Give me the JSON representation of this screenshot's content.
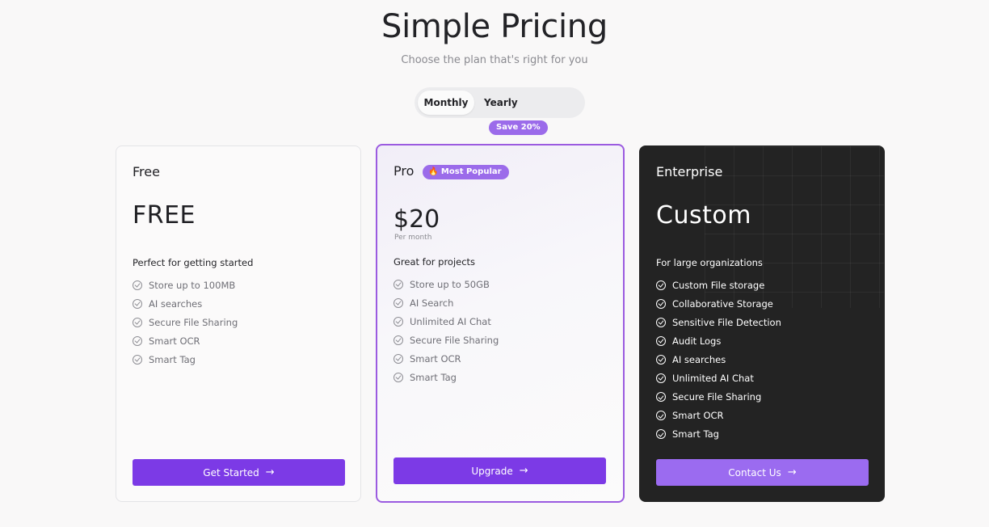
{
  "header": {
    "title": "Simple Pricing",
    "subtitle": "Choose the plan that's right for you"
  },
  "billing_toggle": {
    "monthly_label": "Monthly",
    "yearly_label": "Yearly",
    "save_badge": "Save 20%",
    "selected": "Monthly"
  },
  "plans": [
    {
      "name": "Free",
      "price": "FREE",
      "tagline": "Perfect for getting started",
      "features": [
        "Store up to 100MB",
        "AI searches",
        "Secure File Sharing",
        "Smart OCR",
        "Smart Tag"
      ],
      "cta": "Get Started"
    },
    {
      "name": "Pro",
      "badge": "🔥 Most Popular",
      "price": "$20",
      "price_period": "Per month",
      "tagline": "Great for projects",
      "features": [
        "Store up to 50GB",
        "AI Search",
        "Unlimited AI Chat",
        "Secure File Sharing",
        "Smart OCR",
        "Smart Tag"
      ],
      "cta": "Upgrade"
    },
    {
      "name": "Enterprise",
      "price": "Custom",
      "tagline": "For large organizations",
      "features": [
        "Custom File storage",
        "Collaborative Storage",
        "Sensitive File Detection",
        "Audit Logs",
        "AI searches",
        "Unlimited AI Chat",
        "Secure File Sharing",
        "Smart OCR",
        "Smart Tag"
      ],
      "cta": "Contact Us"
    }
  ],
  "icons": {
    "feature": "check-circle-icon",
    "cta": "arrow-right-icon"
  },
  "colors": {
    "accent": "#7c3ae6",
    "badge": "#9b6bea",
    "enterprise_bg": "#232323"
  }
}
